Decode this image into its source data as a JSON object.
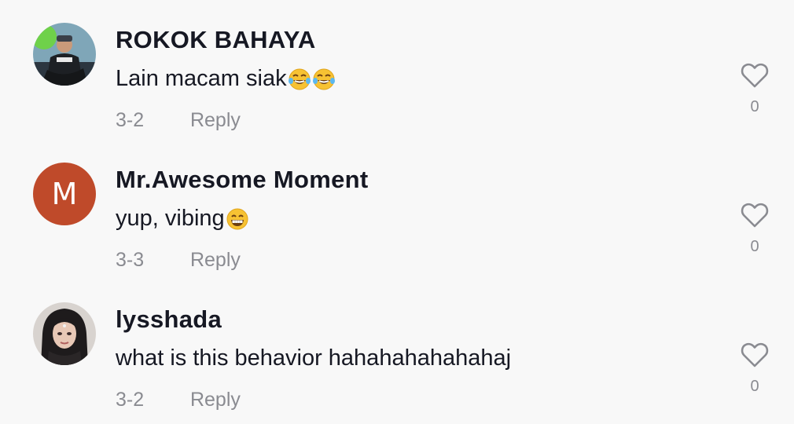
{
  "comments": [
    {
      "username": "ROKOK BAHAYA",
      "text": "Lain macam siak",
      "emoji_icons": [
        "tears-of-joy-icon",
        "tears-of-joy-icon"
      ],
      "date": "3-2",
      "reply_label": "Reply",
      "like_icon": "heart-outline-icon",
      "likes": "0",
      "avatar": "photo"
    },
    {
      "username": "Mr.Awesome Moment",
      "text": "yup, vibing",
      "emoji_icons": [
        "beaming-face-icon"
      ],
      "date": "3-3",
      "reply_label": "Reply",
      "like_icon": "heart-outline-icon",
      "likes": "0",
      "avatar_letter": "M",
      "avatar_color": "#bf4a2a"
    },
    {
      "username": "lysshada",
      "text": "what is this behavior hahahahahahahaj",
      "emoji_icons": [],
      "date": "3-2",
      "reply_label": "Reply",
      "like_icon": "heart-outline-icon",
      "likes": "0",
      "avatar": "photo"
    }
  ],
  "colors": {
    "background": "#f8f8f8",
    "text_primary": "#161823",
    "text_secondary": "#8a8b91"
  }
}
